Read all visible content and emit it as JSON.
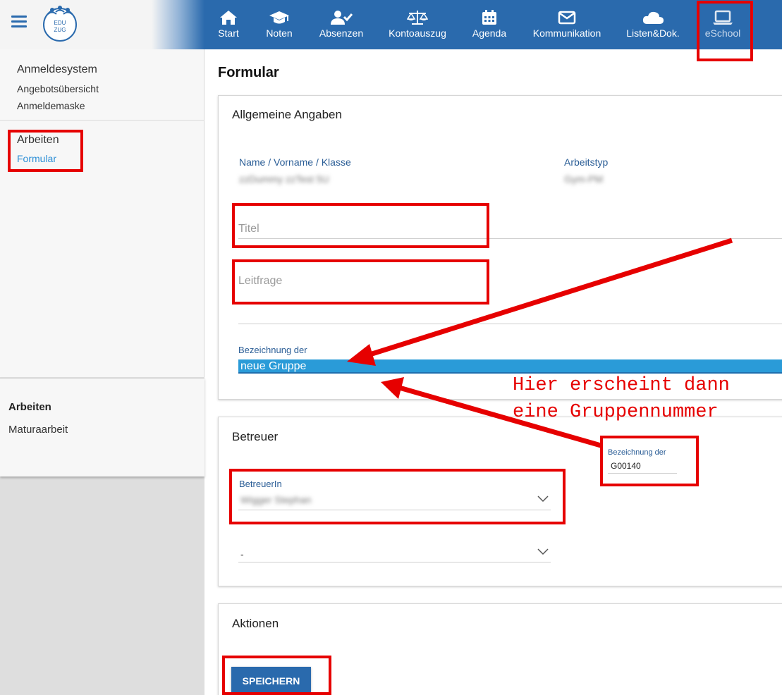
{
  "app": {
    "logo_text_line1": "EDU",
    "logo_text_line2": "ZUG"
  },
  "nav": [
    {
      "label": "Start",
      "icon": "home-icon"
    },
    {
      "label": "Noten",
      "icon": "graduation-cap-icon"
    },
    {
      "label": "Absenzen",
      "icon": "user-check-icon"
    },
    {
      "label": "Kontoauszug",
      "icon": "balance-scale-icon"
    },
    {
      "label": "Agenda",
      "icon": "calendar-icon"
    },
    {
      "label": "Kommunikation",
      "icon": "envelope-icon"
    },
    {
      "label": "Listen&Dok.",
      "icon": "cloud-icon"
    },
    {
      "label": "eSchool",
      "icon": "laptop-icon"
    }
  ],
  "sidebar": {
    "group1_title": "Anmeldesystem",
    "group1_items": [
      "Angebotsübersicht",
      "Anmeldemaske"
    ],
    "group2_title": "Arbeiten",
    "group2_active": "Formular",
    "bottom_title": "Arbeiten",
    "bottom_item": "Maturaarbeit"
  },
  "main": {
    "title": "Formular",
    "general": {
      "heading": "Allgemeine Angaben",
      "name_label": "Name / Vorname / Klasse",
      "name_value": "zzDummy zzTest 5U",
      "type_label": "Arbeitstyp",
      "type_value": "Gym-PM",
      "titel_placeholder": "Titel",
      "leitfrage_placeholder": "Leitfrage",
      "group_label": "Bezeichnung der",
      "group_value": "neue Gruppe"
    },
    "betreuer": {
      "heading": "Betreuer",
      "betreuer_label": "BetreuerIn",
      "betreuer_value": "Wigger Stephan",
      "second_value": "-"
    },
    "actions": {
      "heading": "Aktionen",
      "save_label": "SPEICHERN"
    }
  },
  "annotation": {
    "line1": "Hier erscheint dann",
    "line2": "eine Gruppennummer",
    "zoom_label": "Bezeichnung der",
    "zoom_value": "G00140"
  },
  "colors": {
    "nav_bg": "#2a6aad",
    "highlight": "#e60000",
    "selection": "#2a9bd8",
    "link_active": "#2e8fd6"
  }
}
